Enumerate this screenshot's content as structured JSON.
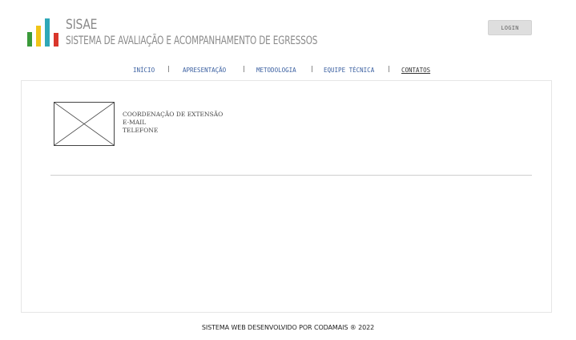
{
  "brand": {
    "short_name": "SISAE",
    "full_name": "SISTEMA DE AVALIAÇÃO E ACOMPANHAMENTO DE EGRESSOS",
    "logo_colors": [
      "#3a9a3a",
      "#f0c419",
      "#2ea8b8",
      "#d9362b"
    ]
  },
  "header": {
    "login_label": "LOGIN"
  },
  "nav": {
    "items": [
      {
        "label": "INÍCIO"
      },
      {
        "label": "APRESENTAÇÃO"
      },
      {
        "label": "METODOLOGIA"
      },
      {
        "label": "EQUIPE TÉCNICA"
      },
      {
        "label": "CONTATOS"
      }
    ],
    "active": "CONTATOS",
    "separator": "|"
  },
  "contact": {
    "image_icon": "image-placeholder-icon",
    "lines": [
      "COORDENAÇÃO DE EXTENSÃO",
      "E-MAIL",
      "TELEFONE"
    ]
  },
  "footer": {
    "text": "SISTEMA WEB DESENVOLVIDO POR CODAMAIS ® 2022"
  }
}
